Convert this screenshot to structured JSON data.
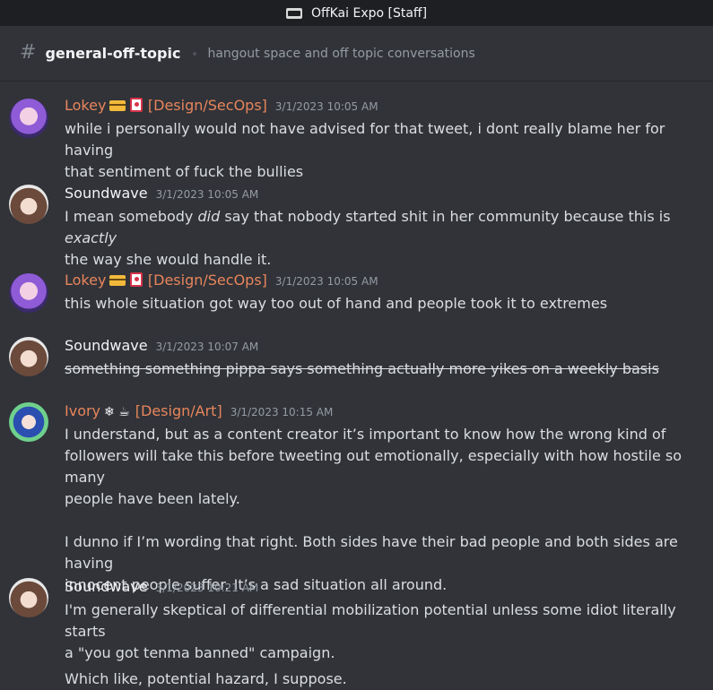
{
  "titlebar": {
    "server_name": "OffKai Expo [Staff]"
  },
  "channel": {
    "hash": "#",
    "name": "general-off-topic",
    "topic": "hangout space and off topic conversations"
  },
  "messages": [
    {
      "author": "Lokey",
      "badges": "💳 🎴",
      "role_tag": "[Design/SecOps]",
      "timestamp": "3/1/2023 10:05 AM",
      "lines": [
        "while i personally would not have advised for that tweet, i dont really blame her for having",
        "that sentiment of fuck the bullies"
      ]
    },
    {
      "author": "Soundwave",
      "timestamp": "3/1/2023 10:05 AM",
      "line1_a": "I mean somebody ",
      "line1_em": "did",
      "line1_b": " say that nobody started shit in her community because this is ",
      "line1_em2": "exactly",
      "line2": "the way she would handle it."
    },
    {
      "author": "Lokey",
      "badges": "💳 🎴",
      "role_tag": "[Design/SecOps]",
      "timestamp": "3/1/2023 10:05 AM",
      "lines": [
        "this whole situation got way too out of hand and people took it to extremes"
      ]
    },
    {
      "author": "Soundwave",
      "timestamp": "3/1/2023 10:07 AM",
      "lines": [
        "something something pippa says something actually more yikes on a weekly basis"
      ]
    },
    {
      "author": "Ivory",
      "badges": "❄ ☕",
      "role_tag": "[Design/Art]",
      "timestamp": "3/1/2023 10:15 AM",
      "lines": [
        "I understand, but as a content creator it’s important to know how the wrong kind of",
        "followers will take this before tweeting out emotionally, especially with how hostile so many",
        "people have been lately.",
        "I dunno if I’m wording that right. Both sides have their bad people and both sides are having",
        "innocent people suffer. It’s a sad situation all around."
      ]
    },
    {
      "author": "Soundwave",
      "timestamp": "3/1/2023 10:21 AM",
      "lines": [
        "I'm generally skeptical of differential mobilization potential unless some idiot literally starts",
        "a \"you got tenma banned\" campaign.",
        "Which like, potential hazard, I suppose."
      ]
    }
  ],
  "colors": {
    "background": "#313338",
    "titlebar": "#1e1f22",
    "role_orange": "#e8855c",
    "timestamp": "#949ba4"
  }
}
